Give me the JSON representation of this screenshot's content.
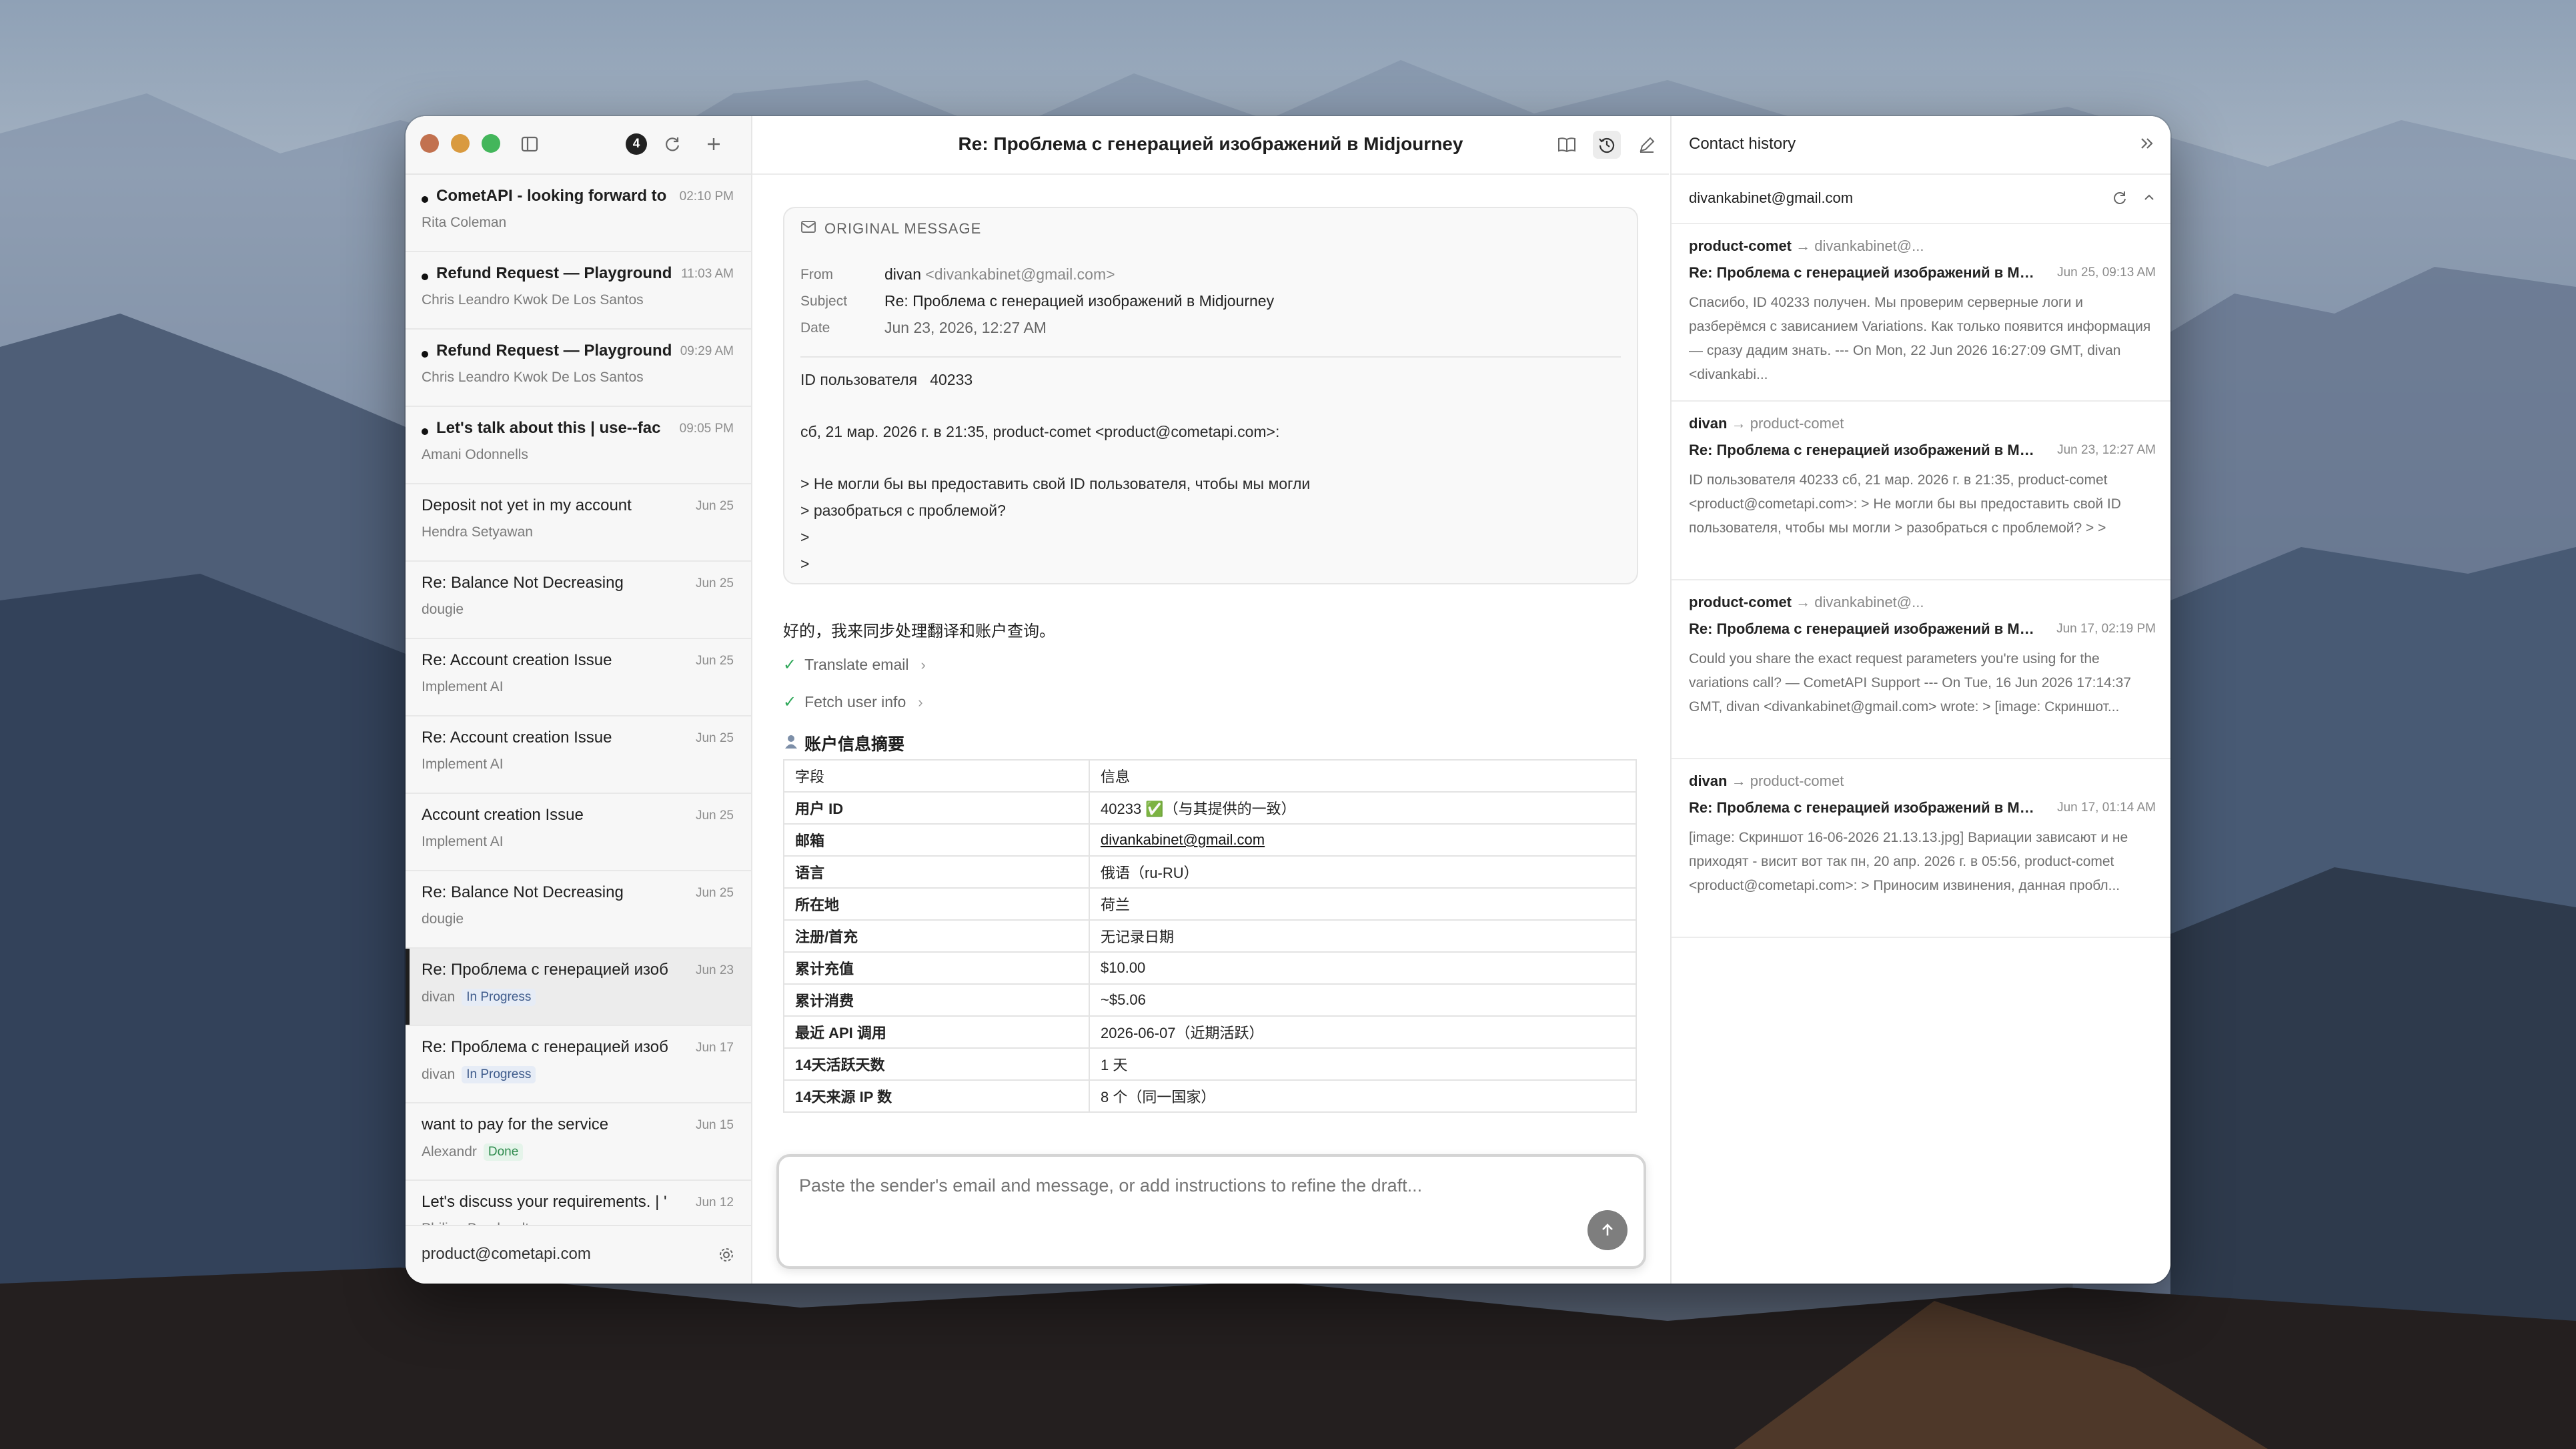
{
  "sidebar": {
    "unread_count": "4",
    "mails": [
      {
        "subject": "CometAPI - looking forward to",
        "date": "02:10 PM",
        "from": "Rita Coleman",
        "unread": true,
        "status": ""
      },
      {
        "subject": "Refund Request — Playground",
        "date": "11:03 AM",
        "from": "Chris Leandro Kwok De Los Santos",
        "unread": true,
        "status": ""
      },
      {
        "subject": "Refund Request — Playground",
        "date": "09:29 AM",
        "from": "Chris Leandro Kwok De Los Santos",
        "unread": true,
        "status": ""
      },
      {
        "subject": "Let's talk about this | use--fac",
        "date": "09:05 PM",
        "from": "Amani Odonnells",
        "unread": true,
        "status": ""
      },
      {
        "subject": "Deposit not yet in my account",
        "date": "Jun 25",
        "from": "Hendra Setyawan",
        "unread": false,
        "status": ""
      },
      {
        "subject": "Re: Balance Not Decreasing",
        "date": "Jun 25",
        "from": "dougie",
        "unread": false,
        "status": ""
      },
      {
        "subject": "Re: Account creation Issue",
        "date": "Jun 25",
        "from": "Implement AI",
        "unread": false,
        "status": ""
      },
      {
        "subject": "Re: Account creation Issue",
        "date": "Jun 25",
        "from": "Implement AI",
        "unread": false,
        "status": ""
      },
      {
        "subject": "Account creation Issue",
        "date": "Jun 25",
        "from": "Implement AI",
        "unread": false,
        "status": ""
      },
      {
        "subject": "Re: Balance Not Decreasing",
        "date": "Jun 25",
        "from": "dougie",
        "unread": false,
        "status": ""
      },
      {
        "subject": "Re: Проблема с генерацией изоб",
        "date": "Jun 23",
        "from": "divan",
        "unread": false,
        "status": "In Progress",
        "selected": true
      },
      {
        "subject": "Re: Проблема с генерацией изоб",
        "date": "Jun 17",
        "from": "divan",
        "unread": false,
        "status": "In Progress"
      },
      {
        "subject": "want to pay for the service",
        "date": "Jun 15",
        "from": "Alexandr",
        "unread": false,
        "status": "Done"
      },
      {
        "subject": "Let's discuss your requirements. | '",
        "date": "Jun 12",
        "from": "Philipp Bernhardt",
        "unread": false,
        "status": ""
      }
    ],
    "account": "product@cometapi.com"
  },
  "main": {
    "title": "Re: Проблема с генерацией изображений в Midjourney",
    "original": {
      "header": "ORIGINAL MESSAGE",
      "from_label": "From",
      "from_name": "divan",
      "from_email": "<divankabinet@gmail.com>",
      "subject_label": "Subject",
      "subject": "Re: Проблема с генерацией изображений в Midjourney",
      "date_label": "Date",
      "date": "Jun 23, 2026, 12:27 AM",
      "body": [
        "ID пользователя   40233",
        "сб, 21 мар. 2026 г. в 21:35, product-comet <product@cometapi.com>:",
        "> Не могли бы вы предоставить свой ID пользователя, чтобы мы могли",
        "> разобраться с проблемой?",
        ">",
        ">"
      ]
    },
    "reply_text": "好的，我来同步处理翻译和账户查询。",
    "tools": [
      "Translate email",
      "Fetch user info"
    ],
    "section_title": "账户信息摘要",
    "table": {
      "header": [
        "字段",
        "信息"
      ],
      "rows": [
        [
          "用户 ID",
          "40233 ✅（与其提供的一致）"
        ],
        [
          "邮箱",
          "divankabinet@gmail.com"
        ],
        [
          "语言",
          "俄语（ru-RU）"
        ],
        [
          "所在地",
          "荷兰"
        ],
        [
          "注册/首充",
          "无记录日期"
        ],
        [
          "累计充值",
          "$10.00"
        ],
        [
          "累计消费",
          "~$5.06"
        ],
        [
          "最近 API 调用",
          "2026-06-07（近期活跃）"
        ],
        [
          "14天活跃天数",
          "1 天"
        ],
        [
          "14天来源 IP 数",
          "8 个（同一国家）"
        ]
      ]
    },
    "composer_placeholder": "Paste the sender's email and message, or add instructions to refine the draft..."
  },
  "history": {
    "title": "Contact history",
    "email": "divankabinet@gmail.com",
    "items": [
      {
        "from": "product-comet",
        "to": "divankabinet@...",
        "subject": "Re: Проблема с генерацией изображений в Midjourney",
        "date": "Jun 25, 09:13 AM",
        "snippet": "Спасибо, ID 40233 получен. Мы проверим серверные логи и разберёмся с зависанием Variations. Как только появится информация — сразу дадим знать. --- On Mon, 22 Jun 2026 16:27:09 GMT, divan <divankabi..."
      },
      {
        "from": "divan",
        "to": "product-comet",
        "subject": "Re: Проблема с генерацией изображений в Midjourney",
        "date": "Jun 23, 12:27 AM",
        "snippet": "ID пользователя 40233 сб, 21 мар. 2026 г. в 21:35, product-comet <product@cometapi.com>: > Не могли бы вы предоставить свой ID пользователя, чтобы мы могли > разобраться с проблемой? > >"
      },
      {
        "from": "product-comet",
        "to": "divankabinet@...",
        "subject": "Re: Проблема с генерацией изображений в Midjourney",
        "date": "Jun 17, 02:19 PM",
        "snippet": "Could you share the exact request parameters you're using for the variations call? — CometAPI Support --- On Tue, 16 Jun 2026 17:14:37 GMT, divan <divankabinet@gmail.com> wrote: > [image: Скриншот..."
      },
      {
        "from": "divan",
        "to": "product-comet",
        "subject": "Re: Проблема с генерацией изображений в Midjourney",
        "date": "Jun 17, 01:14 AM",
        "snippet": "[image: Скриншот 16-06-2026 21.13.13.jpg] Вариации зависают и не приходят - висит вот так пн, 20 апр. 2026 г. в 05:56, product-comet <product@cometapi.com>: > Приносим извинения, данная пробл..."
      }
    ]
  },
  "colors": {
    "close": "#c2714f",
    "minimize": "#d99a3f",
    "zoom": "#43b65b",
    "check": "#2fa85a",
    "in_progress": "#3d5a8a",
    "done": "#2d8a4c"
  },
  "icons": [
    "sidebar-toggle-icon",
    "refresh-icon",
    "plus-icon",
    "book-icon",
    "history-icon",
    "edit-icon",
    "collapse-panel-icon",
    "refresh-icon",
    "chevron-up-icon",
    "mail-icon",
    "user-icon",
    "settings-icon",
    "arrow-up-icon"
  ]
}
